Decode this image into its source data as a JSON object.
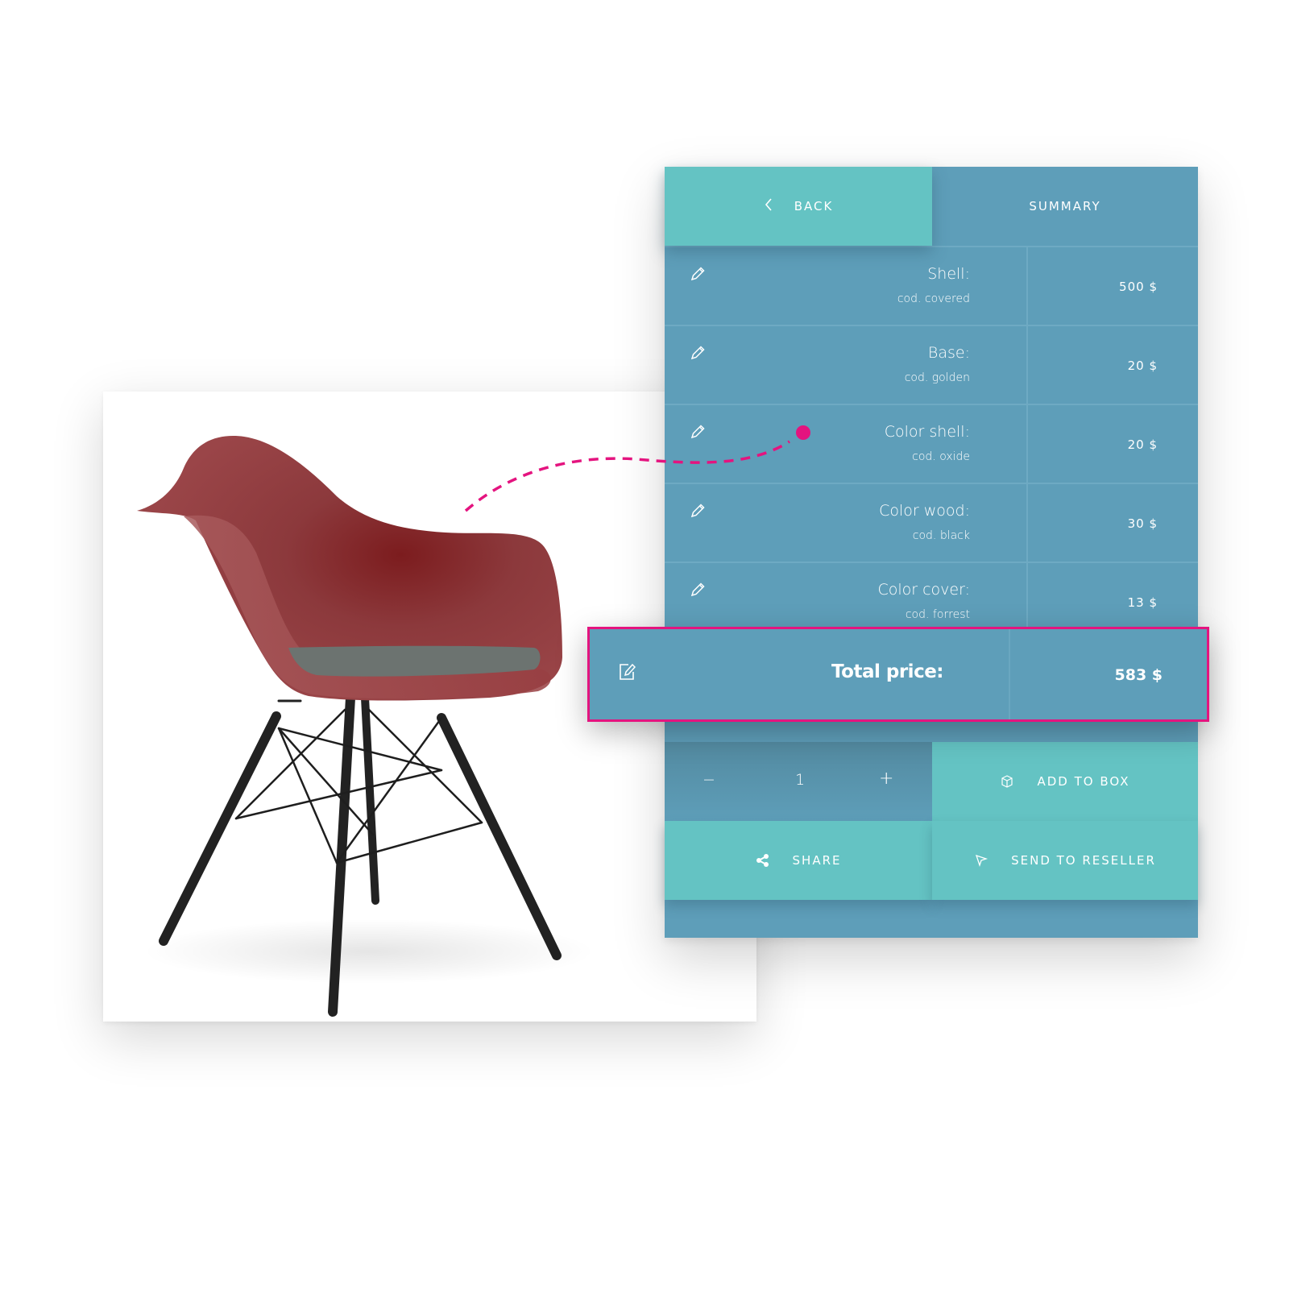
{
  "colors": {
    "panel_blue": "#5e9eb9",
    "accent_teal": "#64c3c3",
    "highlight_pink": "#e4147f",
    "chair_red": "#8e3a3d"
  },
  "header": {
    "back_label": "BACK",
    "back_icon": "chevron-left-icon",
    "summary_label": "SUMMARY"
  },
  "items": [
    {
      "name": "Shell:",
      "code": "cod. covered",
      "price": "500 $"
    },
    {
      "name": "Base:",
      "code": "cod. golden",
      "price": "20 $"
    },
    {
      "name": "Color shell:",
      "code": "cod. oxide",
      "price": "20 $"
    },
    {
      "name": "Color wood:",
      "code": "cod. black",
      "price": "30 $"
    },
    {
      "name": "Color cover:",
      "code": "cod. forrest",
      "price": "13 $"
    }
  ],
  "total": {
    "label": "Total price:",
    "price": "583 $",
    "icon": "edit-square-icon"
  },
  "quantity": {
    "minus": "−",
    "value": "1",
    "plus": "+"
  },
  "actions": {
    "add_to_box": "ADD TO BOX",
    "add_icon": "box-icon",
    "share": "SHARE",
    "share_icon": "share-icon",
    "send_to_reseller": "SEND TO RESELLER",
    "send_icon": "cursor-arrow-icon"
  },
  "product": {
    "image": "red armchair with grey seat cushion and black wooden legs"
  }
}
